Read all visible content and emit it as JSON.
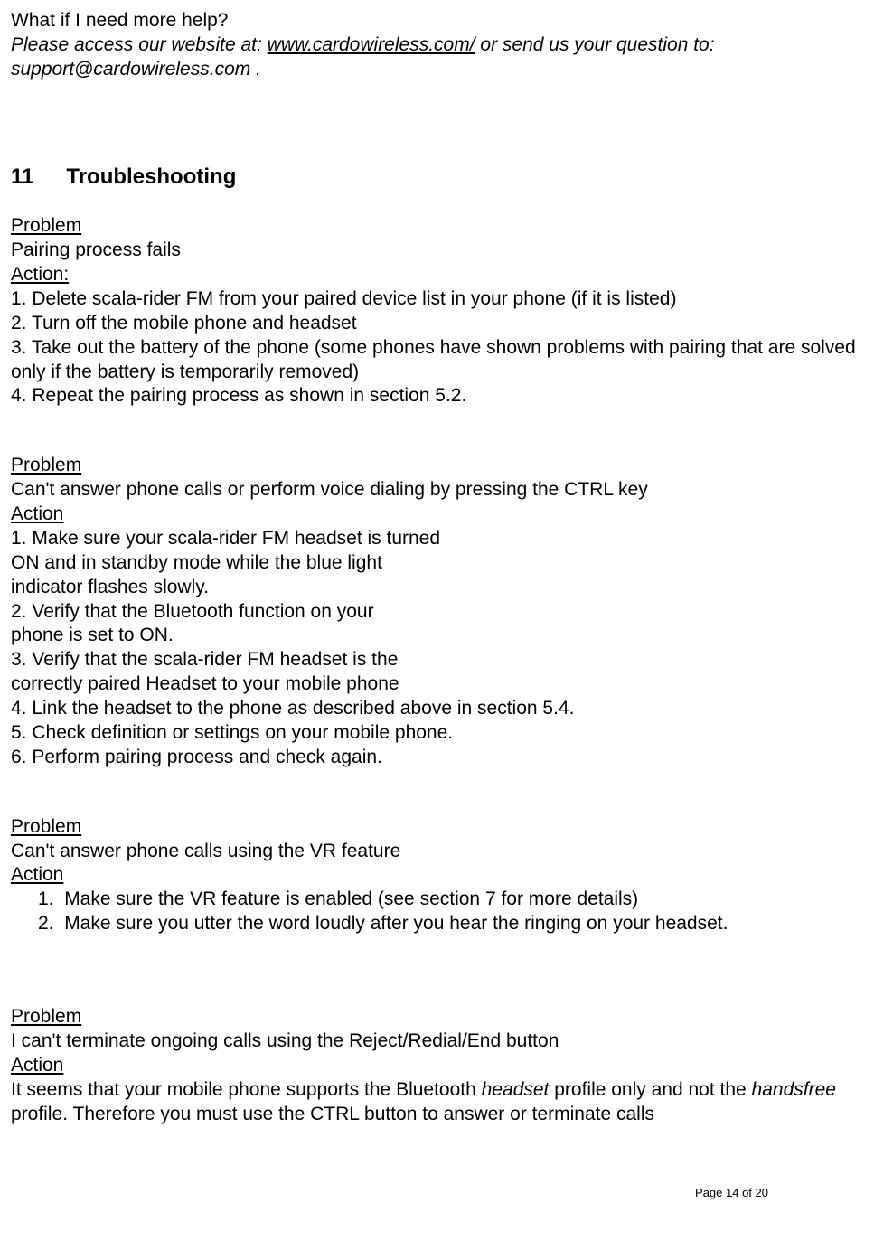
{
  "intro": {
    "q": "What if I need more help?",
    "pre": "Please access our website at: ",
    "link": "www.cardowireless.com/",
    "post": " or send us your question to: support@cardowireless.com .",
    "post_line2_prefix": "support@cardowireless.com ."
  },
  "heading": {
    "num": "11",
    "title": "Troubleshooting"
  },
  "p1": {
    "label_problem": "Problem",
    "problem": "Pairing process fails",
    "label_action": "Action:",
    "a1": "1. Delete scala-rider FM from your paired device list in your phone (if it is listed)",
    "a2": "2. Turn off the mobile phone and headset",
    "a3": "3. Take out the battery of the phone (some phones have shown problems with pairing that are solved only if the battery is temporarily removed)",
    "a4": "4. Repeat the pairing process as shown in section 5.2."
  },
  "p2": {
    "label_problem": "Problem",
    "problem": "Can't answer phone calls or perform voice dialing by pressing the CTRL key",
    "label_action": "Action",
    "a1a": "1. Make sure your scala-rider FM headset is turned",
    "a1b": "ON and in standby mode while the blue light",
    "a1c": "indicator flashes slowly.",
    "a2a": "2. Verify that the Bluetooth function on your",
    "a2b": "phone is set to ON.",
    "a3a": "3. Verify that the scala-rider FM headset is the",
    "a3b": "correctly paired Headset to your mobile phone",
    "a4": "4. Link the headset to the phone as described above in section 5.4.",
    "a5": "5. Check definition or settings on your mobile phone.",
    "a6": "6. Perform pairing process and check again."
  },
  "p3": {
    "label_problem": "Problem",
    "problem": "Can't answer phone calls using the VR feature",
    "label_action": "Action",
    "i1_num": "1.",
    "i1": "Make sure the VR feature is enabled (see section 7 for more details)",
    "i2_num": "2.",
    "i2": "Make sure you utter the word loudly after you hear the ringing on your headset."
  },
  "p4": {
    "label_problem": "Problem",
    "problem": "I can't terminate ongoing calls using the Reject/Redial/End button",
    "label_action": "Action",
    "t1": "It seems that your mobile phone supports the Bluetooth ",
    "t_headset": "headset",
    "t2": " profile only and not the ",
    "t_handsfree": "handsfree",
    "t3": " profile. Therefore you must use the CTRL button to answer or terminate calls"
  },
  "footer": "Page 14 of 20"
}
